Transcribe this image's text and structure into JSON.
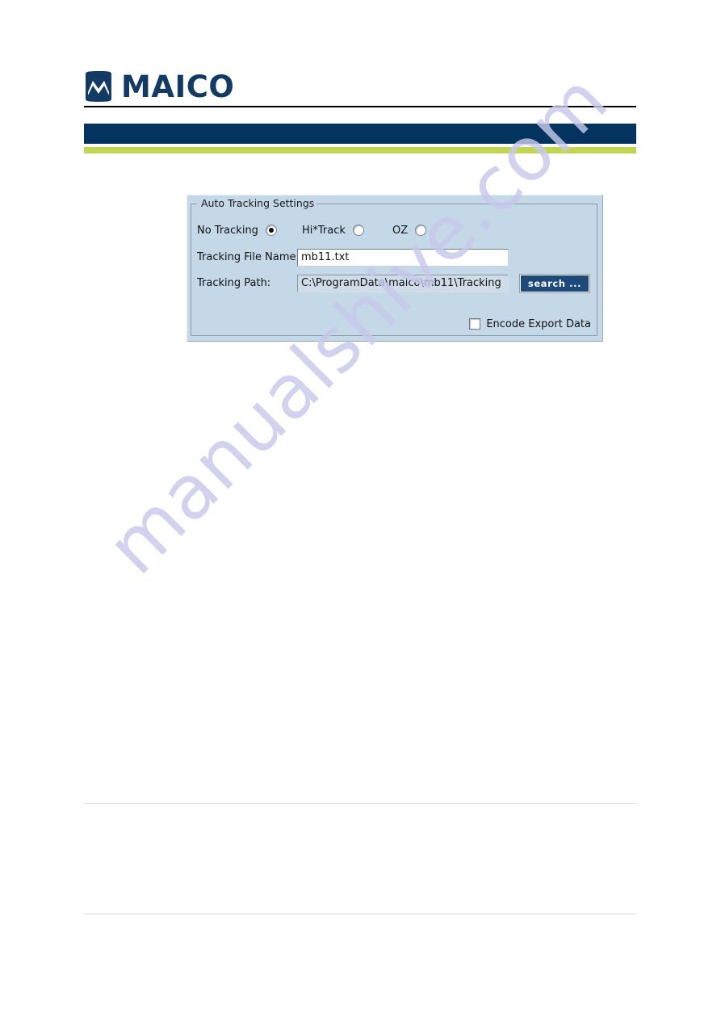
{
  "brand": {
    "logo_wordmark": "MAICO",
    "logo_icon": "maico-wave-mark",
    "navy": "#05335f",
    "green": "#c3d356",
    "logo_blue": "#123a63"
  },
  "watermark": {
    "text": "manualshive.com",
    "color": "#c7c9ea"
  },
  "dialog": {
    "group_legend": "Auto Tracking Settings",
    "panel_color": "#c5d8e8",
    "tracking_modes": [
      {
        "label": "No Tracking",
        "selected": true
      },
      {
        "label": "Hi*Track",
        "selected": false
      },
      {
        "label": "OZ",
        "selected": false
      }
    ],
    "fields": [
      {
        "label": "Tracking File Name:",
        "value": "mb11.txt",
        "editable": true
      },
      {
        "label": "Tracking Path:",
        "value": "C:\\ProgramData\\maico\\mb11\\Tracking",
        "editable": false
      }
    ],
    "search_button": {
      "label": "search ...",
      "color": "#1d4a7a"
    },
    "encode_checkbox": {
      "label": "Encode Export Data",
      "checked": false
    }
  }
}
